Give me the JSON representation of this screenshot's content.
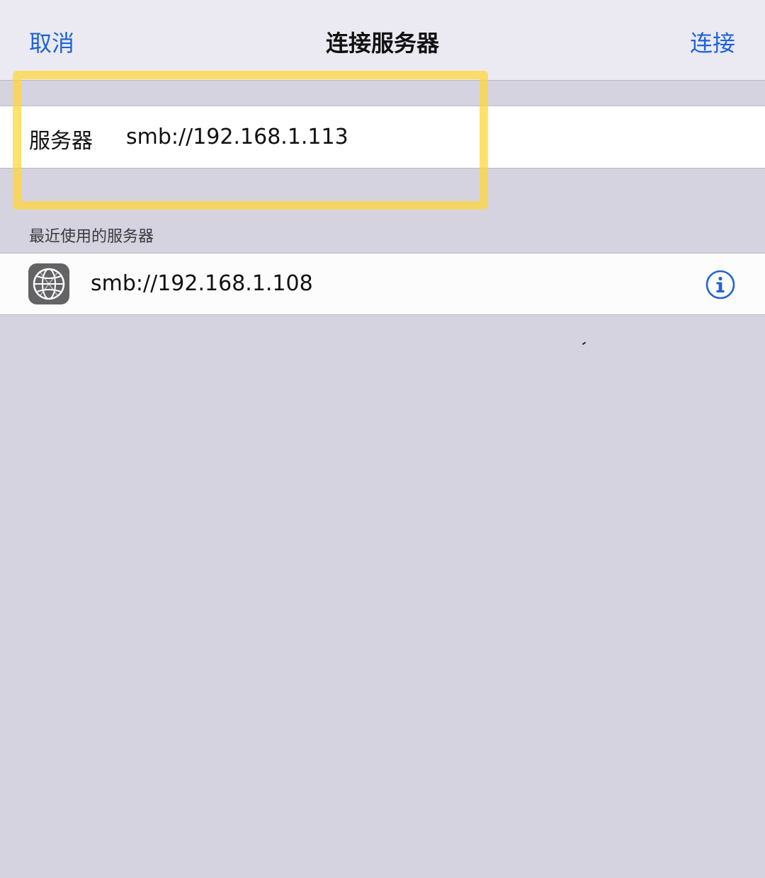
{
  "nav": {
    "cancel_label": "取消",
    "title": "连接服务器",
    "connect_label": "连接"
  },
  "server_field": {
    "label": "服务器",
    "value": "smb://192.168.1.113"
  },
  "recent": {
    "header": "最近使用的服务器",
    "items": [
      {
        "address": "smb://192.168.1.108",
        "icon": "network-globe-icon",
        "info_icon": "info-icon"
      }
    ]
  },
  "colors": {
    "accent": "#1f63d6",
    "background": "#d6d3e0",
    "highlight": "#ffd73c"
  }
}
